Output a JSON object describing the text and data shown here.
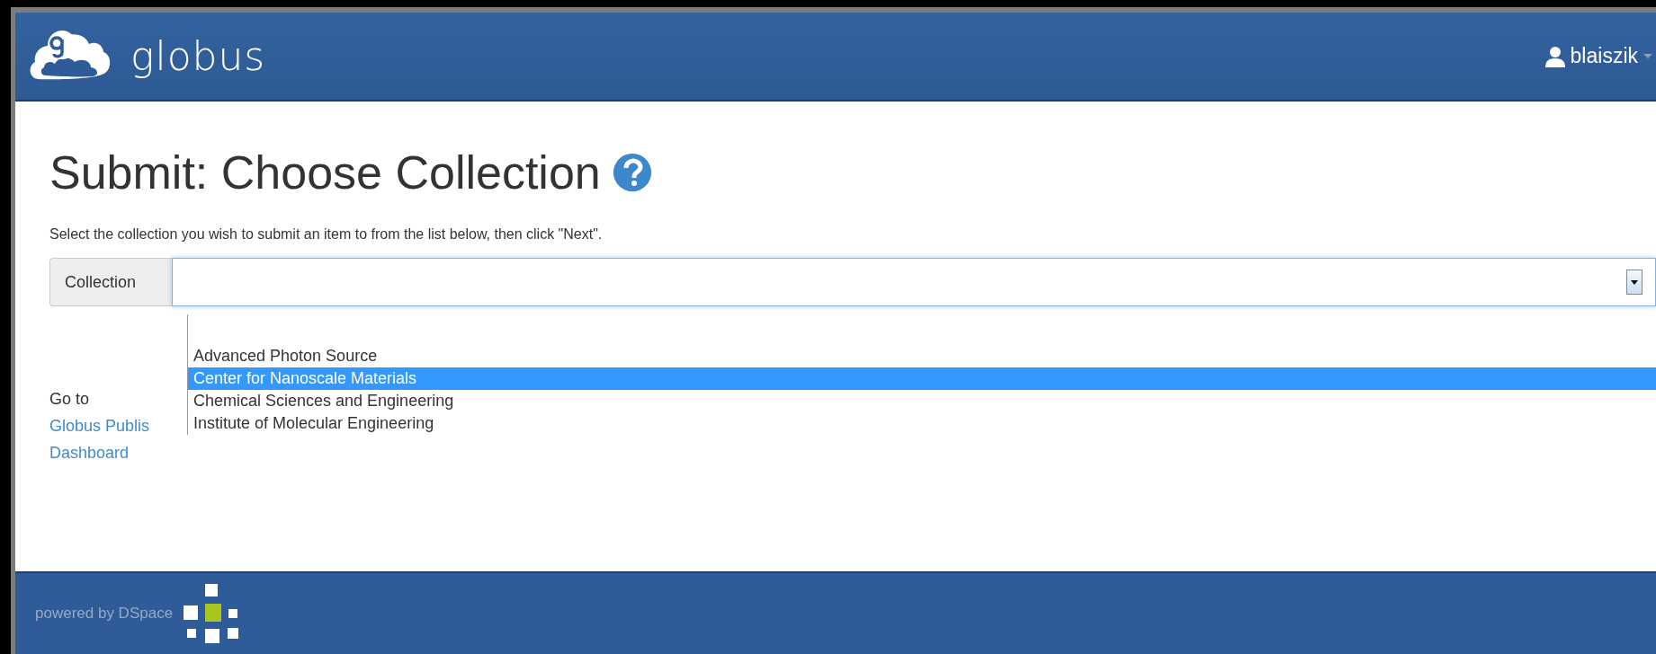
{
  "brand": {
    "name": "globus"
  },
  "user": {
    "name": "blaiszik"
  },
  "page": {
    "title": "Submit: Choose Collection",
    "description": "Select the collection you wish to submit an item to from the list below, then click \"Next\"."
  },
  "collection_field": {
    "label": "Collection",
    "options": [
      {
        "label": "Advanced Photon Source",
        "selected": false
      },
      {
        "label": "Center for Nanoscale Materials",
        "selected": true
      },
      {
        "label": "Chemical Sciences and Engineering",
        "selected": false
      },
      {
        "label": "Institute of Molecular Engineering",
        "selected": false
      }
    ]
  },
  "goto": {
    "label": "Go to",
    "links": [
      "Globus Publis",
      "Dashboard"
    ]
  },
  "footer": {
    "text": "powered by DSpace"
  }
}
